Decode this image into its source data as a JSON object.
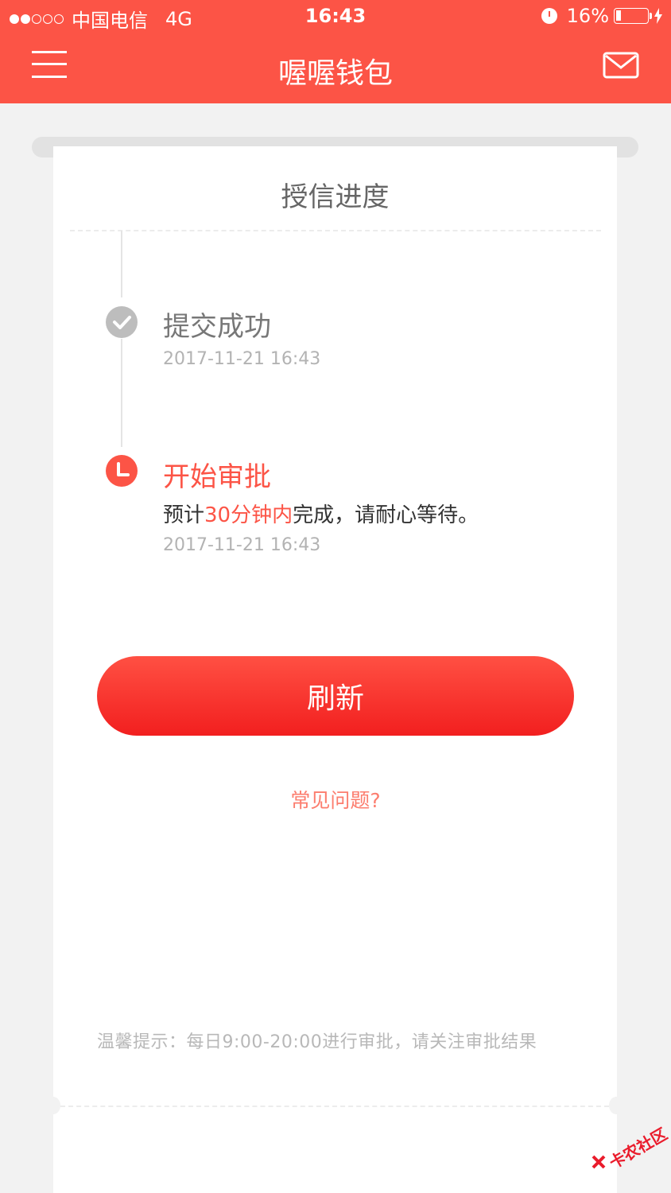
{
  "status_bar": {
    "carrier": "中国电信",
    "network": "4G",
    "time": "16:43",
    "battery_percent": "16%",
    "battery_level": 0.16
  },
  "nav": {
    "title": "喔喔钱包",
    "menu_icon": "hamburger-menu-icon",
    "mail_icon": "envelope-icon"
  },
  "card": {
    "title": "授信进度"
  },
  "steps": [
    {
      "title": "提交成功",
      "time": "2017-11-21 16:43",
      "icon": "check-circle-icon",
      "status": "done"
    },
    {
      "title": "开始审批",
      "desc_prefix": "预计",
      "desc_highlight": "30分钟内",
      "desc_suffix": "完成，请耐心等待。",
      "time": "2017-11-21 16:43",
      "icon": "clock-icon",
      "status": "current"
    }
  ],
  "actions": {
    "refresh_label": "刷新",
    "faq_label": "常见问题?"
  },
  "tip": "温馨提示：每日9:00-20:00进行审批，请关注审批结果",
  "watermark": "卡农社区",
  "colors": {
    "brand": "#fc5446",
    "link": "#fc7d6e",
    "muted": "#b3b3b3",
    "background": "#f2f2f2"
  }
}
